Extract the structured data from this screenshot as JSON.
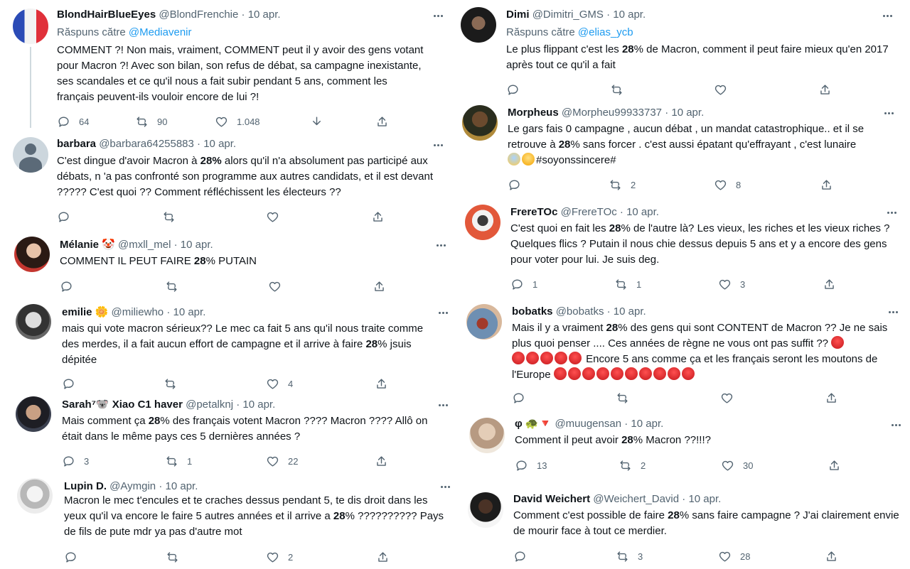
{
  "left": [
    {
      "name": "BlondHairBlueEyes",
      "handle": "@BlondFrenchie",
      "date": "10 apr.",
      "reply_prefix": "Răspuns către",
      "reply_to": "@Mediavenir",
      "text": "COMMENT ?! Non mais, vraiment, COMMENT peut il y avoir des gens votant pour Macron ?! Avec son bilan, son refus de débat, sa campagne inexistante, ses scandales et ce qu'il nous a fait subir pendant 5 ans, comment les français peuvent-ils vouloir encore de lui ?!",
      "replies": "64",
      "retweets": "90",
      "likes": "1.048"
    },
    {
      "name": "barbara",
      "handle": "@barbara64255883",
      "date": "10 apr.",
      "text_pre": "C'est dingue d'avoir Macron à ",
      "text_bold": "28%",
      "text_post": " alors qu'il n'a absolument pas participé aux débats, n 'a pas confronté son programme aux autres candidats, et il est devant ????? C'est quoi ?? Comment réfléchissent les électeurs ??",
      "replies": "",
      "retweets": "",
      "likes": ""
    },
    {
      "name": "Mélanie 🤡",
      "handle": "@mxll_mel",
      "date": "10 apr.",
      "text_pre": "COMMENT IL PEUT FAIRE ",
      "text_bold": "28",
      "text_post": "% PUTAIN",
      "replies": "",
      "retweets": "",
      "likes": ""
    },
    {
      "name": "emilie 🌼",
      "handle": "@miliewho",
      "date": "10 apr.",
      "text_pre": "mais qui vote macron sérieux?? Le mec ca fait 5 ans qu'il nous traite comme des merdes, il a fait aucun effort de campagne et il arrive à faire ",
      "text_bold": "28",
      "text_post": "% jsuis dépitée",
      "replies": "",
      "retweets": "",
      "likes": "4"
    },
    {
      "name": "Sarah⁷🐨 Xiao C1 haver",
      "handle": "@petalknj",
      "date": "10 apr.",
      "text_pre": "Mais comment ça ",
      "text_bold": "28",
      "text_post": "% des français votent Macron ???? Macron ???? Allô on était dans le même pays ces 5 dernières années ?",
      "replies": "3",
      "retweets": "1",
      "likes": "22"
    },
    {
      "name": "Lupin D.",
      "handle": "@Aymgin",
      "date": "10 apr.",
      "text_pre": "Macron le mec t'encules et te craches dessus pendant 5, te dis droit dans les yeux qu'il va encore le faire 5 autres années et il arrive a ",
      "text_bold": "28",
      "text_post": "% ?????????? Pays de fils de pute mdr ya pas d'autre mot",
      "replies": "",
      "retweets": "",
      "likes": "2"
    }
  ],
  "right": [
    {
      "name": "Dimi",
      "handle": "@Dimitri_GMS",
      "date": "10 apr.",
      "reply_prefix": "Răspuns către",
      "reply_to": "@elias_ycb",
      "text_pre": "Le plus flippant c'est les ",
      "text_bold": "28",
      "text_post": "% de Macron, comment il peut faire mieux qu'en 2017 après tout ce qu'il a fait",
      "replies": "",
      "retweets": "",
      "likes": ""
    },
    {
      "name": "Morpheus",
      "handle": "@Morpheu99933737",
      "date": "10 apr.",
      "text_pre": "Le gars fais 0 campagne , aucun débat , un mandat catastrophique.. et il se retrouve à ",
      "text_bold": "28",
      "text_post": "% sans forcer . c'est aussi épatant qu'effrayant , c'est lunaire",
      "text_line3": "#soyonssincere#",
      "replies": "",
      "retweets": "2",
      "likes": "8"
    },
    {
      "name": "FrereTOc",
      "handle": "@FrereTOc",
      "date": "10 apr.",
      "text_pre": "C'est quoi en fait les ",
      "text_bold": "28",
      "text_post": "% de l'autre là? Les vieux, les riches et les vieux riches ? Quelques flics ? Putain il nous chie dessus depuis 5 ans et y a encore des gens pour voter pour lui. Je suis deg.",
      "replies": "1",
      "retweets": "1",
      "likes": "3"
    },
    {
      "name": "bobatks",
      "handle": "@bobatks",
      "date": "10 apr.",
      "text_pre": "Mais il y a vraiment ",
      "text_bold": "28",
      "text_post": "% des gens qui sont CONTENT de Macron ?? Je ne sais plus quoi penser .... Ces années de règne ne vous ont pas suffit ??",
      "text_mid": " Encore 5 ans comme ça et les français seront les moutons de l'Europe",
      "replies": "",
      "retweets": "",
      "likes": ""
    },
    {
      "name": "φ 🐢🔻",
      "handle": "@muugensan",
      "date": "10 apr.",
      "text_pre": "Comment il peut avoir ",
      "text_bold": "28",
      "text_post": "% Macron ??!!!?",
      "replies": "13",
      "retweets": "2",
      "likes": "30"
    },
    {
      "name": "David Weichert",
      "handle": "@Weichert_David",
      "date": "10 apr.",
      "text_pre": "Comment c'est possible de faire ",
      "text_bold": "28",
      "text_post": "% sans faire campagne ? J'ai clairement envie de mourir face à tout ce merdier.",
      "replies": "",
      "retweets": "3",
      "likes": "28"
    }
  ],
  "first_text_bold_none": true
}
